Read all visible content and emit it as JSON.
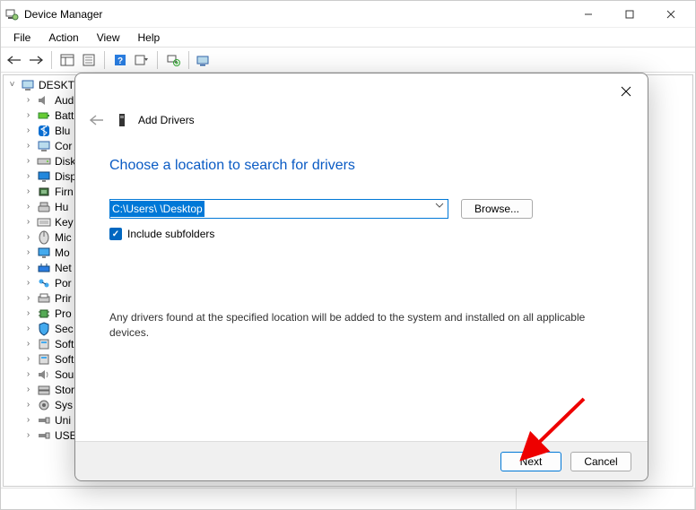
{
  "window": {
    "title": "Device Manager"
  },
  "menubar": {
    "items": [
      "File",
      "Action",
      "View",
      "Help"
    ]
  },
  "tree": {
    "root": "DESKTO",
    "children": [
      {
        "icon": "audio",
        "label": "Aud"
      },
      {
        "icon": "battery",
        "label": "Batt"
      },
      {
        "icon": "bluetooth",
        "label": "Blu"
      },
      {
        "icon": "computer",
        "label": "Cor"
      },
      {
        "icon": "disk",
        "label": "Disk"
      },
      {
        "icon": "display",
        "label": "Disp"
      },
      {
        "icon": "firmware",
        "label": "Firn"
      },
      {
        "icon": "hid",
        "label": "Hu"
      },
      {
        "icon": "keyboard",
        "label": "Key"
      },
      {
        "icon": "mouse",
        "label": "Mic"
      },
      {
        "icon": "monitor",
        "label": "Mo"
      },
      {
        "icon": "network",
        "label": "Net"
      },
      {
        "icon": "port",
        "label": "Por"
      },
      {
        "icon": "printqueue",
        "label": "Prir"
      },
      {
        "icon": "processor",
        "label": "Pro"
      },
      {
        "icon": "security",
        "label": "Sec"
      },
      {
        "icon": "software",
        "label": "Soft"
      },
      {
        "icon": "software",
        "label": "Soft"
      },
      {
        "icon": "sound",
        "label": "Sou"
      },
      {
        "icon": "storage",
        "label": "Stor"
      },
      {
        "icon": "system",
        "label": "Sys"
      },
      {
        "icon": "usb",
        "label": "Uni"
      },
      {
        "icon": "usb",
        "label": "USE"
      }
    ]
  },
  "dialog": {
    "title": "Add Drivers",
    "heading": "Choose a location to search for drivers",
    "path_value": "C:\\Users\\        \\Desktop",
    "browse_label": "Browse...",
    "include_subfolders_label": "Include subfolders",
    "info": "Any drivers found at the specified location will be added to the system and installed on all applicable devices.",
    "next_label": "Next",
    "cancel_label": "Cancel"
  }
}
